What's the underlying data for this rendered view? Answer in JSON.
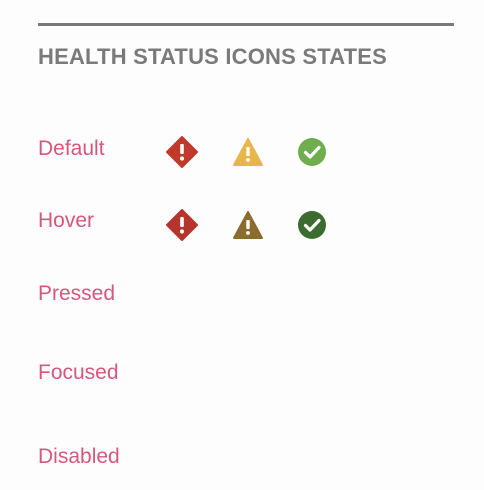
{
  "section": {
    "title": "HEALTH STATUS ICONS STATES"
  },
  "states": [
    {
      "label": "Default"
    },
    {
      "label": "Hover"
    },
    {
      "label": "Pressed"
    },
    {
      "label": "Focused"
    },
    {
      "label": "Disabled"
    }
  ],
  "icons": {
    "default": {
      "error": {
        "icon": "error-diamond-icon",
        "color": "#c0392b"
      },
      "warning": {
        "icon": "warning-triangle-icon",
        "color": "#e6b64a"
      },
      "success": {
        "icon": "success-check-circle-icon",
        "color": "#6fae4e"
      }
    },
    "hover": {
      "error": {
        "icon": "error-diamond-icon",
        "color": "#b3352b"
      },
      "warning": {
        "icon": "warning-triangle-icon",
        "color": "#8a6d2c"
      },
      "success": {
        "icon": "success-check-circle-icon",
        "color": "#3c6b30"
      }
    }
  },
  "colors": {
    "title": "#7a7a7a",
    "label": "#d6577e",
    "rule": "#7a7a7a"
  }
}
